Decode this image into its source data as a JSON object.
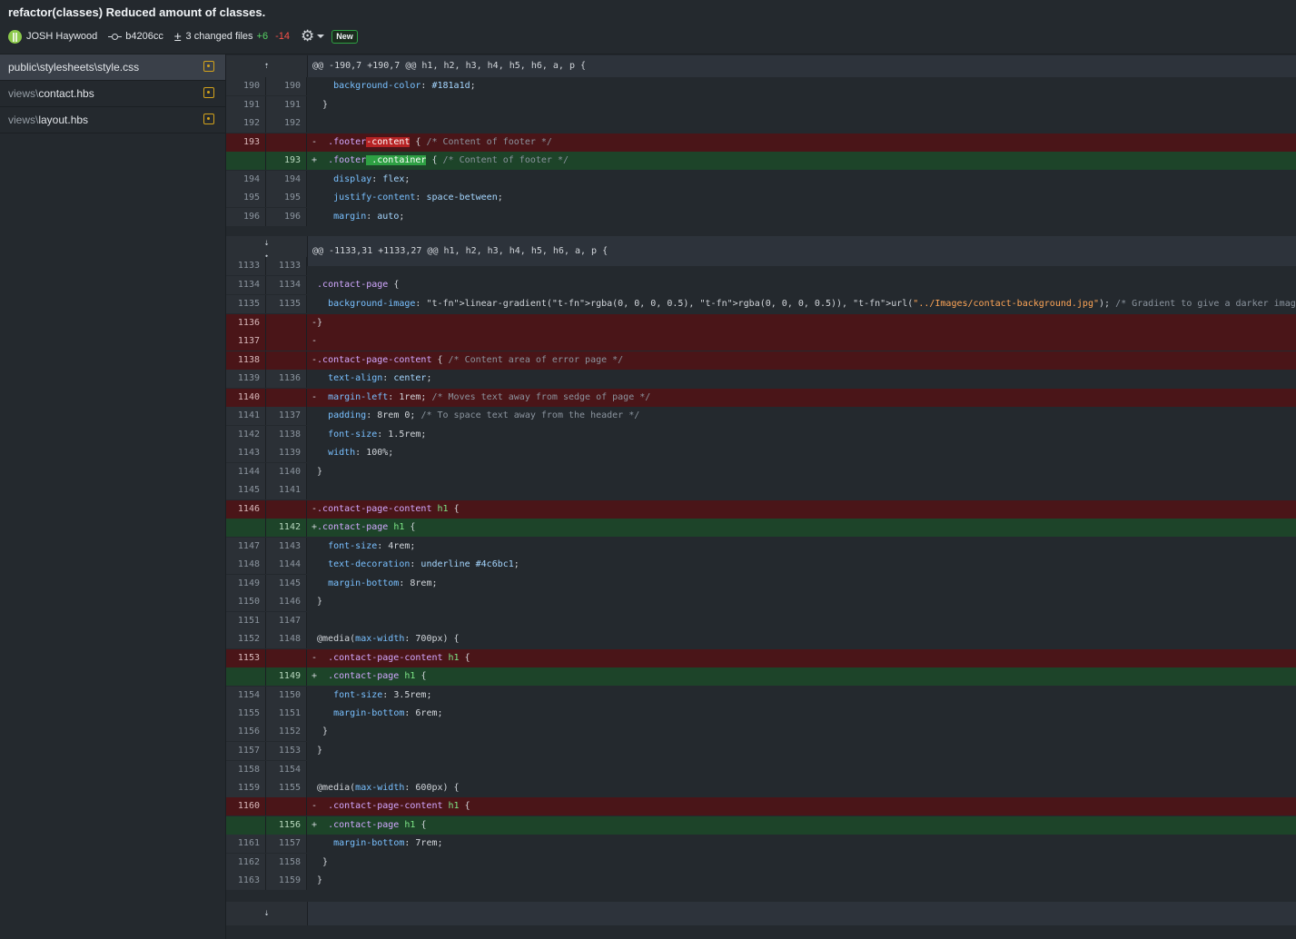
{
  "header": {
    "title": "refactor(classes) Reduced amount of classes.",
    "author": "JOSH Haywood",
    "commit_hash": "b4206cc",
    "changed_files": "3 changed files",
    "additions": "+6",
    "deletions": "-14",
    "badge": "New"
  },
  "sidebar": {
    "files": [
      {
        "dir": "public\\stylesheets\\",
        "name": "style.css",
        "status_icon": "modified-icon"
      },
      {
        "dir": "views\\",
        "name": "contact.hbs",
        "status_icon": "modified-icon"
      },
      {
        "dir": "views\\",
        "name": "layout.hbs",
        "status_icon": "modified-icon"
      }
    ]
  },
  "diff": {
    "expand_up_glyph": "⇡",
    "expand_down_glyph": "⇣",
    "lines": [
      {
        "type": "hunk",
        "old": "",
        "new": "",
        "text": "@@ -190,7 +190,7 @@ h1, h2, h3, h4, h5, h6, a, p {"
      },
      {
        "type": "ctx",
        "old": "190",
        "new": "190",
        "text": "    background-color: #181a1d;"
      },
      {
        "type": "ctx",
        "old": "191",
        "new": "191",
        "text": "  }"
      },
      {
        "type": "ctx",
        "old": "192",
        "new": "192",
        "text": ""
      },
      {
        "type": "del",
        "old": "193",
        "new": "",
        "text": "-  .footer-content { /* Content of footer */"
      },
      {
        "type": "add",
        "old": "",
        "new": "193",
        "text": "+  .footer .container { /* Content of footer */"
      },
      {
        "type": "ctx",
        "old": "194",
        "new": "194",
        "text": "    display: flex;"
      },
      {
        "type": "ctx",
        "old": "195",
        "new": "195",
        "text": "    justify-content: space-between;"
      },
      {
        "type": "ctx",
        "old": "196",
        "new": "196",
        "text": "    margin: auto;"
      },
      {
        "type": "hunk",
        "old": "",
        "new": "",
        "text": "@@ -1133,31 +1133,27 @@ h1, h2, h3, h4, h5, h6, a, p {"
      },
      {
        "type": "ctx",
        "old": "1133",
        "new": "1133",
        "text": ""
      },
      {
        "type": "ctx",
        "old": "1134",
        "new": "1134",
        "text": " .contact-page {"
      },
      {
        "type": "ctx",
        "old": "1135",
        "new": "1135",
        "text": "   background-image: linear-gradient(rgba(0, 0, 0, 0.5), rgba(0, 0, 0, 0.5)), url(\"../Images/contact-background.jpg\"); /* Gradient to give a darker image colour */"
      },
      {
        "type": "del",
        "old": "1136",
        "new": "",
        "text": "-}"
      },
      {
        "type": "del",
        "old": "1137",
        "new": "",
        "text": "-"
      },
      {
        "type": "del",
        "old": "1138",
        "new": "",
        "text": "-.contact-page-content { /* Content area of error page */"
      },
      {
        "type": "ctx",
        "old": "1139",
        "new": "1136",
        "text": "   text-align: center;"
      },
      {
        "type": "del",
        "old": "1140",
        "new": "",
        "text": "-  margin-left: 1rem; /* Moves text away from sedge of page */"
      },
      {
        "type": "ctx",
        "old": "1141",
        "new": "1137",
        "text": "   padding: 8rem 0; /* To space text away from the header */"
      },
      {
        "type": "ctx",
        "old": "1142",
        "new": "1138",
        "text": "   font-size: 1.5rem;"
      },
      {
        "type": "ctx",
        "old": "1143",
        "new": "1139",
        "text": "   width: 100%;"
      },
      {
        "type": "ctx",
        "old": "1144",
        "new": "1140",
        "text": " }"
      },
      {
        "type": "ctx",
        "old": "1145",
        "new": "1141",
        "text": ""
      },
      {
        "type": "del",
        "old": "1146",
        "new": "",
        "text": "-.contact-page-content h1 {"
      },
      {
        "type": "add",
        "old": "",
        "new": "1142",
        "text": "+.contact-page h1 {"
      },
      {
        "type": "ctx",
        "old": "1147",
        "new": "1143",
        "text": "   font-size: 4rem;"
      },
      {
        "type": "ctx",
        "old": "1148",
        "new": "1144",
        "text": "   text-decoration: underline #4c6bc1;"
      },
      {
        "type": "ctx",
        "old": "1149",
        "new": "1145",
        "text": "   margin-bottom: 8rem;"
      },
      {
        "type": "ctx",
        "old": "1150",
        "new": "1146",
        "text": " }"
      },
      {
        "type": "ctx",
        "old": "1151",
        "new": "1147",
        "text": ""
      },
      {
        "type": "ctx",
        "old": "1152",
        "new": "1148",
        "text": " @media(max-width: 700px) {"
      },
      {
        "type": "del",
        "old": "1153",
        "new": "",
        "text": "-  .contact-page-content h1 {"
      },
      {
        "type": "add",
        "old": "",
        "new": "1149",
        "text": "+  .contact-page h1 {"
      },
      {
        "type": "ctx",
        "old": "1154",
        "new": "1150",
        "text": "    font-size: 3.5rem;"
      },
      {
        "type": "ctx",
        "old": "1155",
        "new": "1151",
        "text": "    margin-bottom: 6rem;"
      },
      {
        "type": "ctx",
        "old": "1156",
        "new": "1152",
        "text": "  }"
      },
      {
        "type": "ctx",
        "old": "1157",
        "new": "1153",
        "text": " }"
      },
      {
        "type": "ctx",
        "old": "1158",
        "new": "1154",
        "text": ""
      },
      {
        "type": "ctx",
        "old": "1159",
        "new": "1155",
        "text": " @media(max-width: 600px) {"
      },
      {
        "type": "del",
        "old": "1160",
        "new": "",
        "text": "-  .contact-page-content h1 {"
      },
      {
        "type": "add",
        "old": "",
        "new": "1156",
        "text": "+  .contact-page h1 {"
      },
      {
        "type": "ctx",
        "old": "1161",
        "new": "1157",
        "text": "    margin-bottom: 7rem;"
      },
      {
        "type": "ctx",
        "old": "1162",
        "new": "1158",
        "text": "  }"
      },
      {
        "type": "ctx",
        "old": "1163",
        "new": "1159",
        "text": " }"
      }
    ]
  },
  "colors": {
    "deleted_bg": "#4a1518",
    "added_bg": "#1d4429",
    "modified_icon": "#d2a21c",
    "badge_border": "#2ea043"
  }
}
